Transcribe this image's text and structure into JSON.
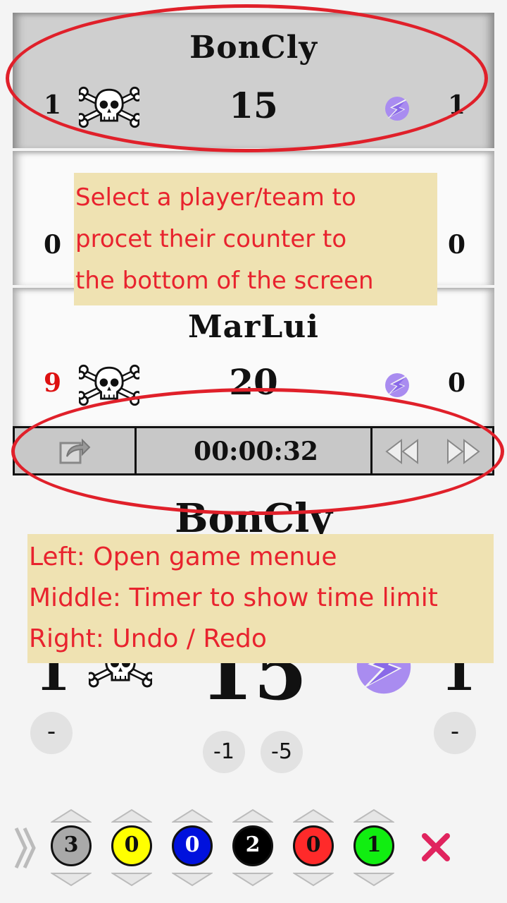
{
  "top_player": {
    "name": "BonCly",
    "left_count": "1",
    "life": "15",
    "right_count": "1"
  },
  "middle_player": {
    "left_count": "0",
    "right_count": "0"
  },
  "third_player": {
    "name": "MarLui",
    "left_count": "9",
    "life": "20",
    "right_count": "0"
  },
  "toolbar": {
    "timer": "00:00:32"
  },
  "focus_player": {
    "name": "BonCly",
    "left_count": "1",
    "life": "15",
    "right_count": "1",
    "minus_left": "-",
    "minus_right": "-",
    "minus_one": "-1",
    "minus_five": "-5"
  },
  "notes": {
    "select_hint": [
      "Select a player/team to",
      "procet their counter to",
      "the bottom of the screen"
    ],
    "toolbar_hint": [
      "Left: Open game menue",
      "Middle: Timer to show time limit",
      "Right: Undo / Redo"
    ]
  },
  "mana_counters": [
    {
      "value": "3",
      "color": "#a9a9a9",
      "text_color": "#111111"
    },
    {
      "value": "0",
      "color": "#ffff00",
      "text_color": "#111111"
    },
    {
      "value": "0",
      "color": "#0011dd",
      "text_color": "#ffffff"
    },
    {
      "value": "2",
      "color": "#000000",
      "text_color": "#ffffff"
    },
    {
      "value": "0",
      "color": "#ff2a2a",
      "text_color": "#111111"
    },
    {
      "value": "1",
      "color": "#11ee11",
      "text_color": "#111111"
    }
  ],
  "colors": {
    "accent_red": "#e0202a",
    "poison_red": "#dd1111",
    "energy_purple": "#a98cf0",
    "close_pink": "#e0245e"
  },
  "icons": {
    "poison": "skull-crossbones-icon",
    "energy": "energy-bolt-icon",
    "menu": "share-icon",
    "undo": "rewind-icon",
    "redo": "fast-forward-icon",
    "expand": "double-chevron-right-icon",
    "close": "close-icon"
  }
}
